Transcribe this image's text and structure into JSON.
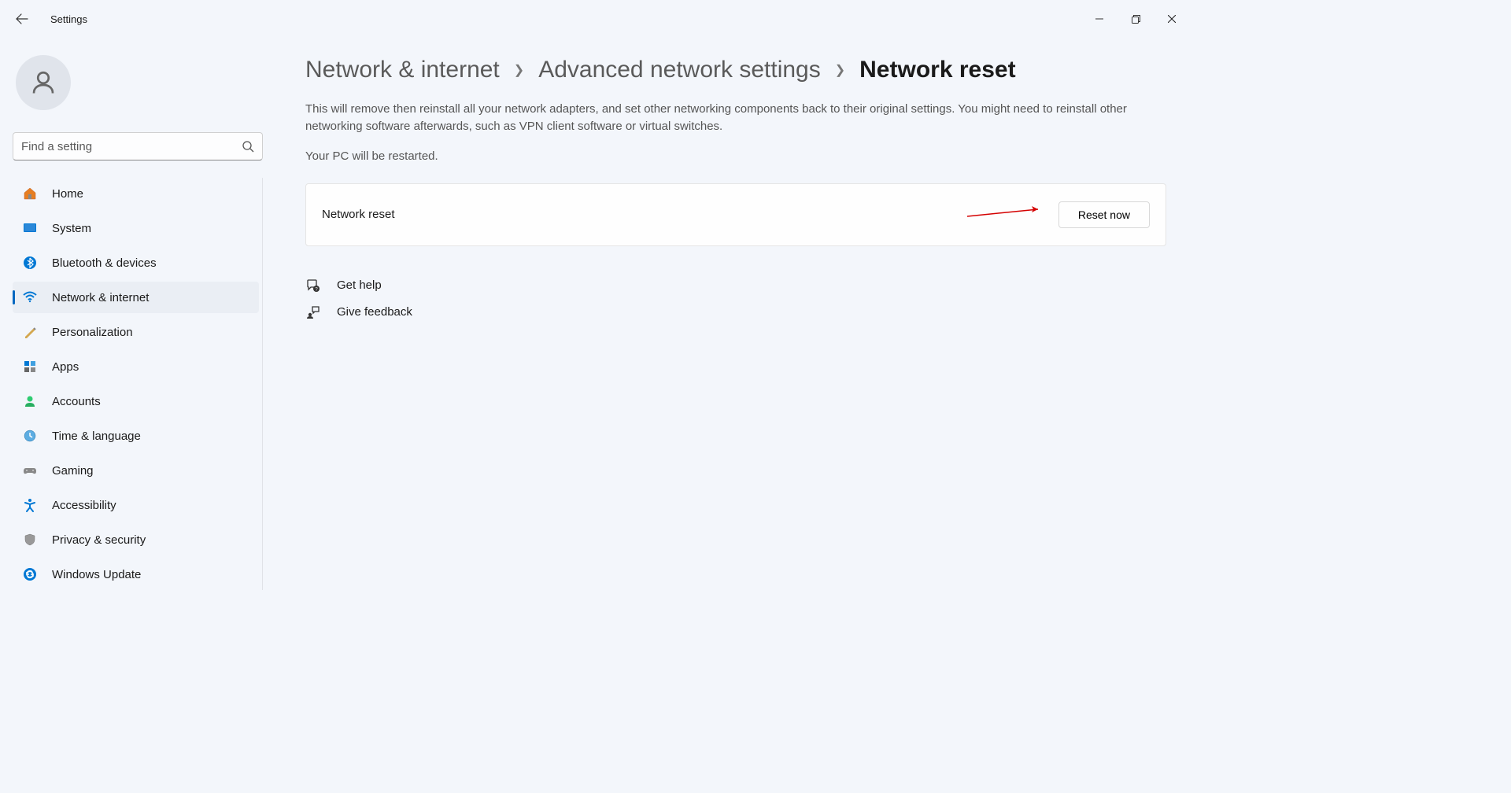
{
  "window": {
    "title": "Settings"
  },
  "search": {
    "placeholder": "Find a setting"
  },
  "nav": {
    "items": [
      {
        "label": "Home"
      },
      {
        "label": "System"
      },
      {
        "label": "Bluetooth & devices"
      },
      {
        "label": "Network & internet"
      },
      {
        "label": "Personalization"
      },
      {
        "label": "Apps"
      },
      {
        "label": "Accounts"
      },
      {
        "label": "Time & language"
      },
      {
        "label": "Gaming"
      },
      {
        "label": "Accessibility"
      },
      {
        "label": "Privacy & security"
      },
      {
        "label": "Windows Update"
      }
    ]
  },
  "breadcrumb": {
    "part1": "Network & internet",
    "part2": "Advanced network settings",
    "current": "Network reset"
  },
  "main": {
    "description": "This will remove then reinstall all your network adapters, and set other networking components back to their original settings. You might need to reinstall other networking software afterwards, such as VPN client software or virtual switches.",
    "restart_note": "Your PC will be restarted.",
    "card_label": "Network reset",
    "reset_button": "Reset now"
  },
  "links": {
    "help": "Get help",
    "feedback": "Give feedback"
  }
}
